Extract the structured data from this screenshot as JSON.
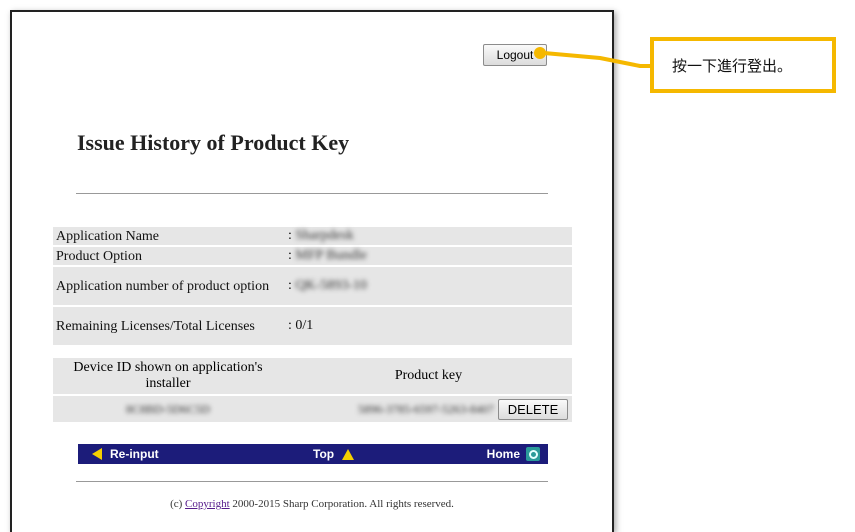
{
  "page": {
    "title": "Issue History of Product Key",
    "logout_label": "Logout"
  },
  "info_rows": [
    {
      "label": "Application Name",
      "value": "Sharpdesk"
    },
    {
      "label": "Product Option",
      "value": "MFP Bundle"
    },
    {
      "label": "Application number of product option",
      "value": "QK-5893-10"
    },
    {
      "label": "Remaining Licenses/Total Licenses",
      "value": ": 0/1"
    }
  ],
  "keys_table": {
    "col_device": "Device ID shown on application's installer",
    "col_key": "Product key",
    "rows": [
      {
        "device_id": "8C8BD-5D6C5D",
        "product_key": "5896-3785-6597-5263-8407",
        "delete_label": "DELETE"
      }
    ]
  },
  "nav": {
    "reinput": "Re-input",
    "top": "Top",
    "home": "Home"
  },
  "footer": {
    "prefix": "(c) ",
    "link": "Copyright",
    "suffix": " 2000-2015 Sharp Corporation. All rights reserved."
  },
  "callout": {
    "text": "按一下進行登出。",
    "color": "#f5b800"
  },
  "colors": {
    "navbar": "#1c1c7a",
    "arrow": "#f5d000",
    "row_bg": "#e6e6e6"
  }
}
